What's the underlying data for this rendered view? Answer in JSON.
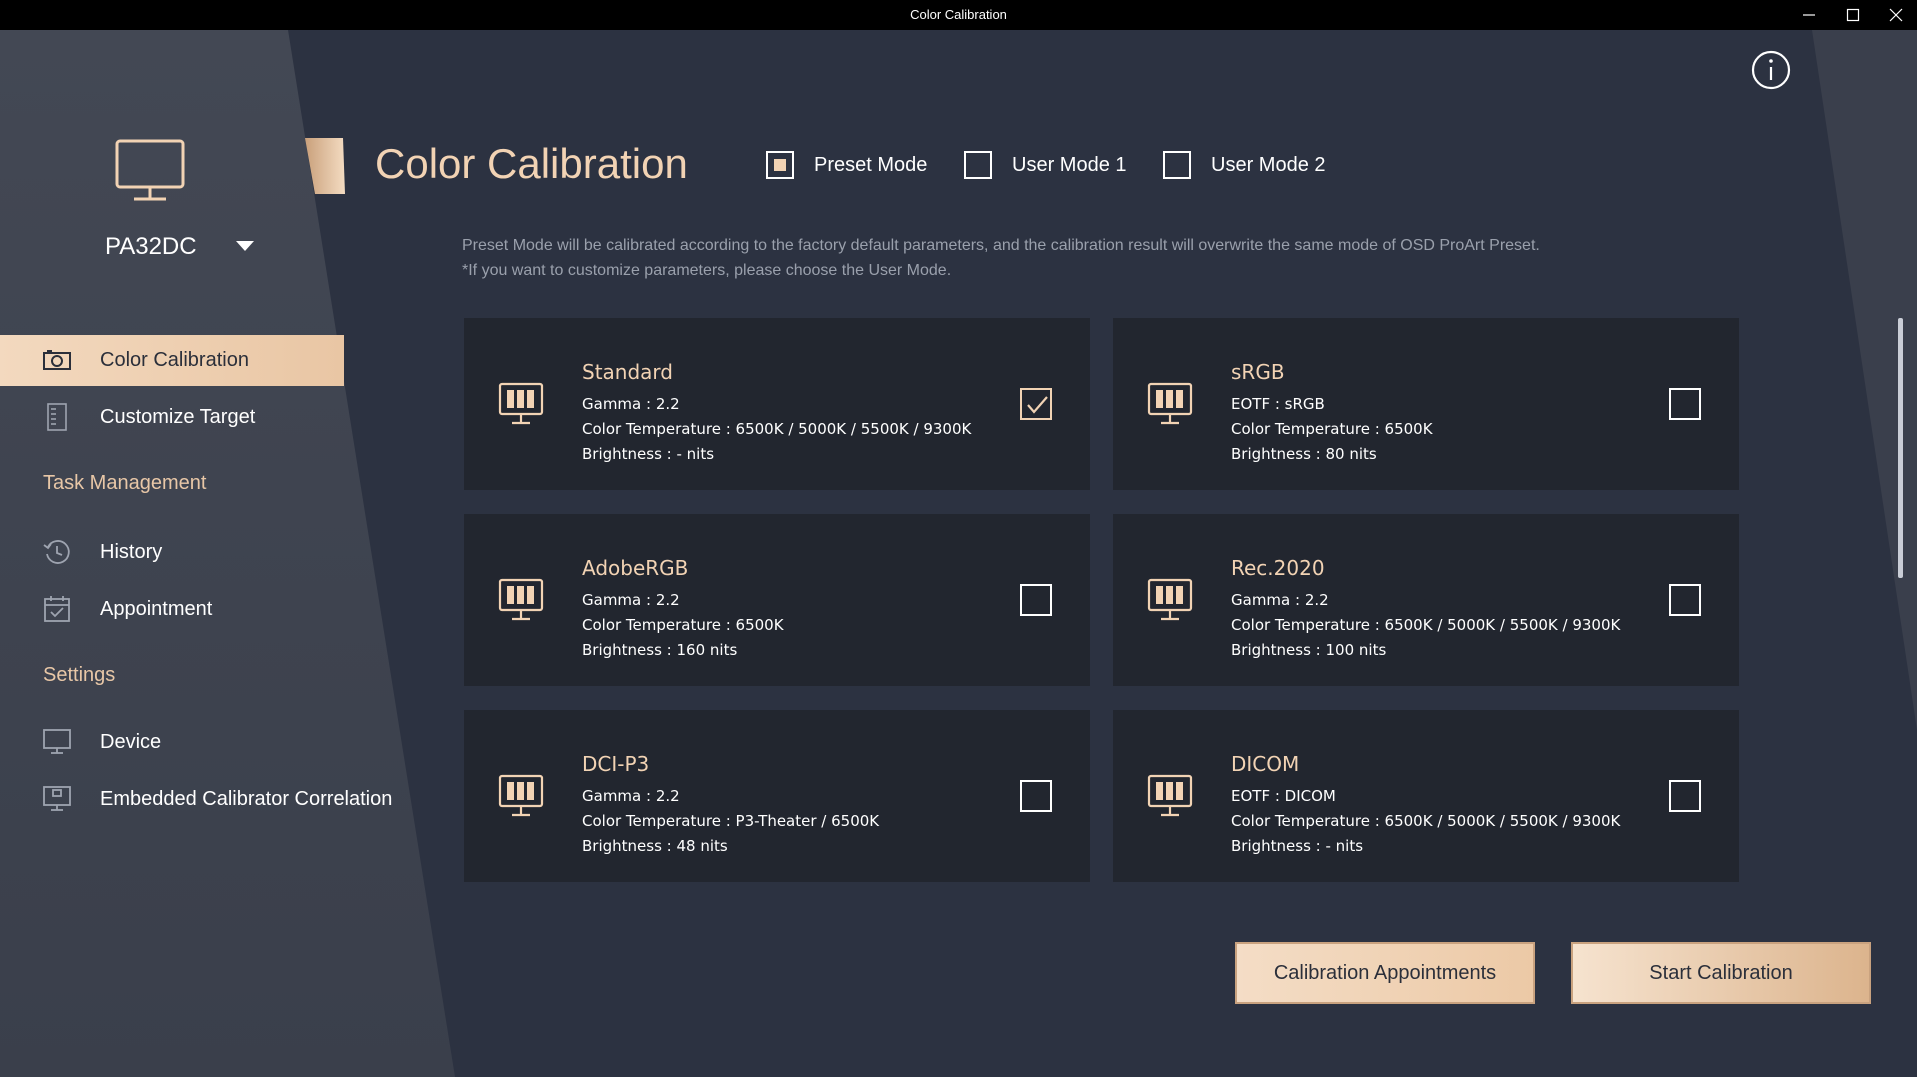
{
  "window": {
    "title": "Color Calibration"
  },
  "sidebar": {
    "device_name": "PA32DC",
    "items": [
      {
        "label": "Color Calibration",
        "icon": "camera-icon",
        "active": true
      },
      {
        "label": "Customize Target",
        "icon": "document-icon"
      }
    ],
    "task_management": {
      "title": "Task Management",
      "items": [
        {
          "label": "History",
          "icon": "history-icon"
        },
        {
          "label": "Appointment",
          "icon": "calendar-check-icon"
        }
      ]
    },
    "settings": {
      "title": "Settings",
      "items": [
        {
          "label": "Device",
          "icon": "monitor-icon"
        },
        {
          "label": "Embedded Calibrator Correlation",
          "icon": "monitor-calibrator-icon"
        }
      ]
    }
  },
  "header": {
    "title": "Color Calibration",
    "modes": [
      {
        "label": "Preset Mode",
        "selected": true
      },
      {
        "label": "User Mode 1",
        "selected": false
      },
      {
        "label": "User Mode 2",
        "selected": false
      }
    ],
    "description_line1": "Preset Mode will be calibrated according to the factory default parameters, and the calibration result will overwrite the same mode of OSD ProArt Preset.",
    "description_line2": "*If you want to customize parameters, please choose the User Mode."
  },
  "presets": [
    {
      "name": "Standard",
      "line1": "Gamma : 2.2",
      "line2": "Color Temperature : 6500K / 5000K / 5500K / 9300K",
      "line3": "Brightness : - nits",
      "checked": true
    },
    {
      "name": "sRGB",
      "line1": "EOTF : sRGB",
      "line2": "Color Temperature : 6500K",
      "line3": "Brightness : 80 nits",
      "checked": false
    },
    {
      "name": "AdobeRGB",
      "line1": "Gamma : 2.2",
      "line2": "Color Temperature : 6500K",
      "line3": "Brightness : 160 nits",
      "checked": false
    },
    {
      "name": "Rec.2020",
      "line1": "Gamma : 2.2",
      "line2": "Color Temperature : 6500K / 5000K / 5500K / 9300K",
      "line3": "Brightness : 100 nits",
      "checked": false
    },
    {
      "name": "DCI-P3",
      "line1": "Gamma : 2.2",
      "line2": "Color Temperature : P3-Theater / 6500K",
      "line3": "Brightness : 48 nits",
      "checked": false
    },
    {
      "name": "DICOM",
      "line1": "EOTF : DICOM",
      "line2": "Color Temperature : 6500K / 5000K / 5500K / 9300K",
      "line3": "Brightness : - nits",
      "checked": false
    }
  ],
  "actions": {
    "appointments_label": "Calibration Appointments",
    "start_label": "Start Calibration"
  },
  "colors": {
    "accent": "#f2d3b4",
    "background": "#2b3140",
    "card": "#22262f",
    "sidebar": "#3e4350"
  }
}
